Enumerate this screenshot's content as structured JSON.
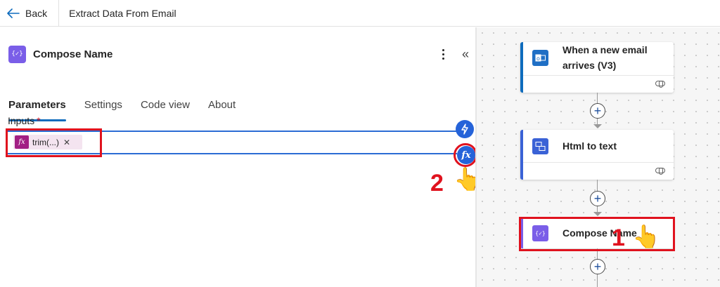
{
  "topbar": {
    "back_label": "Back",
    "flow_title": "Extract Data From Email"
  },
  "panel": {
    "action_icon_label": "{✓}",
    "title": "Compose Name",
    "tabs": [
      {
        "label": "Parameters",
        "active": true
      },
      {
        "label": "Settings",
        "active": false
      },
      {
        "label": "Code view",
        "active": false
      },
      {
        "label": "About",
        "active": false
      }
    ],
    "inputs_label": "Inputs",
    "required_mark": "*",
    "token": {
      "icon_label": "fx",
      "text": "trim(...)",
      "remove_label": "✕"
    },
    "fx_button_label": "fx"
  },
  "annotations": {
    "step_2": "2",
    "step_1": "1",
    "pointer_icon": "pointing-hand-icon"
  },
  "canvas": {
    "cards": [
      {
        "title": "When a new email arrives (V3)",
        "icon": "outlook-icon"
      },
      {
        "title": "Html to text",
        "icon": "html-to-text-icon"
      },
      {
        "title": "Compose Name",
        "icon": "compose-icon",
        "icon_label": "{✓}"
      }
    ]
  },
  "colors": {
    "accent": "#0f6cbd",
    "compose": "#7a5ee8",
    "highlight": "#e0121e",
    "token_bg": "#f4e4f0",
    "token_icon": "#a21f84"
  }
}
